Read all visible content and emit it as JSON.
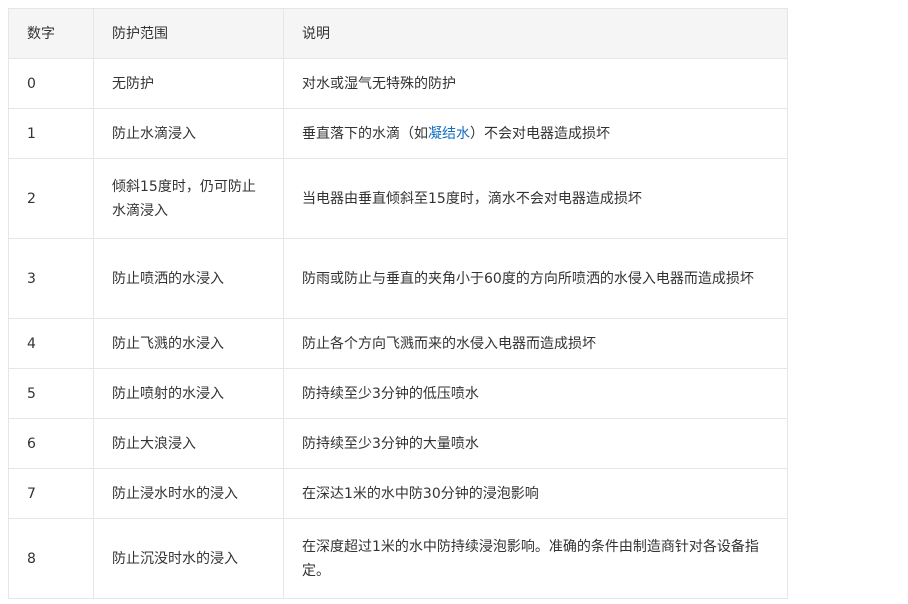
{
  "table": {
    "headers": {
      "code": "数字",
      "range": "防护范围",
      "desc": "说明"
    },
    "rows": [
      {
        "code": "0",
        "range": "无防护",
        "desc": "对水或湿气无特殊的防护"
      },
      {
        "code": "1",
        "range": "防止水滴浸入",
        "desc_pre": "垂直落下的水滴（如",
        "desc_link": "凝结水",
        "desc_post": "）不会对电器造成损坏"
      },
      {
        "code": "2",
        "range": "倾斜15度时，仍可防止水滴浸入",
        "desc": "当电器由垂直倾斜至15度时，滴水不会对电器造成损坏"
      },
      {
        "code": "3",
        "range": "防止喷洒的水浸入",
        "desc": "防雨或防止与垂直的夹角小于60度的方向所喷洒的水侵入电器而造成损坏"
      },
      {
        "code": "4",
        "range": "防止飞溅的水浸入",
        "desc": "防止各个方向飞溅而来的水侵入电器而造成损坏"
      },
      {
        "code": "5",
        "range": "防止喷射的水浸入",
        "desc": "防持续至少3分钟的低压喷水"
      },
      {
        "code": "6",
        "range": "防止大浪浸入",
        "desc": "防持续至少3分钟的大量喷水"
      },
      {
        "code": "7",
        "range": "防止浸水时水的浸入",
        "desc": "在深达1米的水中防30分钟的浸泡影响"
      },
      {
        "code": "8",
        "range": "防止沉没时水的浸入",
        "desc": "在深度超过1米的水中防持续浸泡影响。准确的条件由制造商针对各设备指定。"
      }
    ]
  }
}
